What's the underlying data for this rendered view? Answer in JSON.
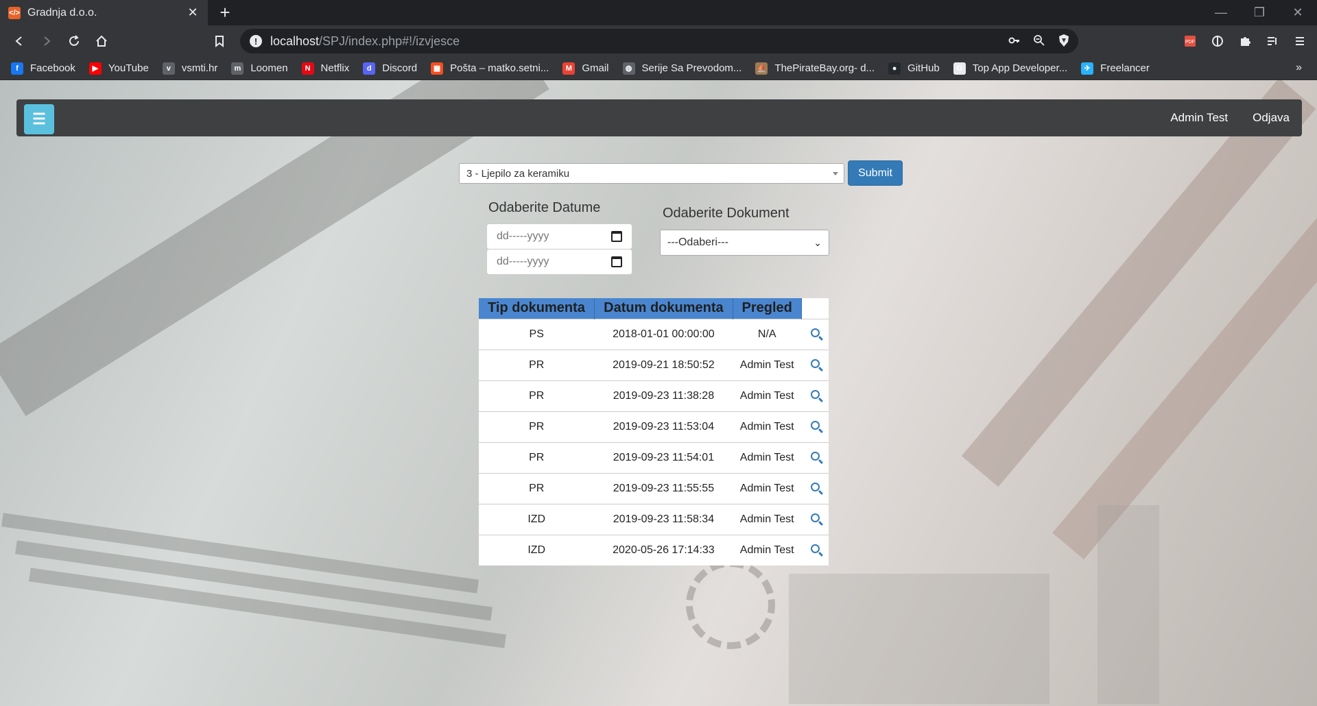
{
  "browser": {
    "tab_title": "Gradnja d.o.o.",
    "tab_favicon": "code-favicon",
    "url_host": "localhost",
    "url_path": "/SPJ/index.php#!/izvjesce",
    "bookmarks": [
      {
        "label": "Facebook",
        "icon": "facebook-icon",
        "color": "#1877f2",
        "glyph": "f"
      },
      {
        "label": "YouTube",
        "icon": "youtube-icon",
        "color": "#ff0000",
        "glyph": "▶"
      },
      {
        "label": "vsmti.hr",
        "icon": "vsmti-icon",
        "color": "#5f6368",
        "glyph": "v"
      },
      {
        "label": "Loomen",
        "icon": "loomen-icon",
        "color": "#5f6368",
        "glyph": "m"
      },
      {
        "label": "Netflix",
        "icon": "netflix-icon",
        "color": "#e50914",
        "glyph": "N"
      },
      {
        "label": "Discord",
        "icon": "discord-icon",
        "color": "#5865f2",
        "glyph": "d"
      },
      {
        "label": "Pošta – matko.setni...",
        "icon": "microsoft-icon",
        "color": "#f25022",
        "glyph": "▦"
      },
      {
        "label": "Gmail",
        "icon": "gmail-icon",
        "color": "#ea4335",
        "glyph": "M"
      },
      {
        "label": "Serije Sa Prevodom...",
        "icon": "globe-icon",
        "color": "#5f6368",
        "glyph": "◍"
      },
      {
        "label": "ThePirateBay.org- d...",
        "icon": "piratebay-icon",
        "color": "#a07a55",
        "glyph": "⛵"
      },
      {
        "label": "GitHub",
        "icon": "github-icon",
        "color": "#24292e",
        "glyph": "●"
      },
      {
        "label": "Top App Developer...",
        "icon": "topapp-icon",
        "color": "#e8eaed",
        "glyph": "G"
      },
      {
        "label": "Freelancer",
        "icon": "freelancer-icon",
        "color": "#29b2fe",
        "glyph": "✈"
      }
    ],
    "bookmarks_more": "»"
  },
  "navbar": {
    "menu_icon": "hamburger-icon",
    "user": "Admin Test",
    "logout": "Odjava"
  },
  "filters": {
    "product_select": "3 - Ljepilo za keramiku",
    "submit": "Submit",
    "dates_label": "Odaberite Datume",
    "date_placeholder_from": "dd-----yyyy",
    "date_placeholder_to": "dd-----yyyy",
    "document_label": "Odaberite Dokument",
    "document_select": "---Odaberi---"
  },
  "table": {
    "headers": [
      "Tip dokumenta",
      "Datum dokumenta",
      "Pregled"
    ],
    "rows": [
      {
        "tip": "PS",
        "datum": "2018-01-01 00:00:00",
        "pregled": "N/A"
      },
      {
        "tip": "PR",
        "datum": "2019-09-21 18:50:52",
        "pregled": "Admin Test"
      },
      {
        "tip": "PR",
        "datum": "2019-09-23 11:38:28",
        "pregled": "Admin Test"
      },
      {
        "tip": "PR",
        "datum": "2019-09-23 11:53:04",
        "pregled": "Admin Test"
      },
      {
        "tip": "PR",
        "datum": "2019-09-23 11:54:01",
        "pregled": "Admin Test"
      },
      {
        "tip": "PR",
        "datum": "2019-09-23 11:55:55",
        "pregled": "Admin Test"
      },
      {
        "tip": "IZD",
        "datum": "2019-09-23 11:58:34",
        "pregled": "Admin Test"
      },
      {
        "tip": "IZD",
        "datum": "2020-05-26 17:14:33",
        "pregled": "Admin Test"
      }
    ]
  },
  "colors": {
    "accent": "#337ab7",
    "menu_button": "#5bc0de",
    "table_header": "#4a86cf",
    "navbar": "#3f4042"
  }
}
